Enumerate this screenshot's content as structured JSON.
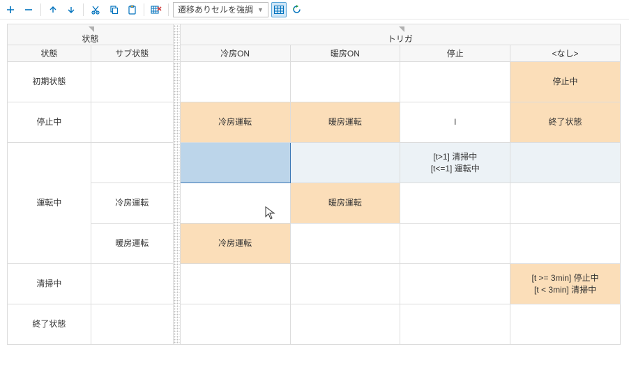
{
  "toolbar": {
    "dropdown": "遷移ありセルを強調"
  },
  "headers": {
    "state_group": "状態",
    "trigger_group": "トリガ",
    "state": "状態",
    "substate": "サブ状態",
    "trig1": "冷房ON",
    "trig2": "暖房ON",
    "trig3": "停止",
    "trig4": "<なし>"
  },
  "rows": {
    "r0_state": "初期状態",
    "r1_state": "停止中",
    "r2_state": "運転中",
    "r2_sub1": "冷房運転",
    "r2_sub2": "暖房運転",
    "r3_state": "清掃中",
    "r4_state": "終了状態"
  },
  "cells": {
    "r0_c4": "停止中",
    "r1_c1": "冷房運転",
    "r1_c2": "暖房運転",
    "r1_c3": "I",
    "r1_c4": "終了状態",
    "r2a_c3": "[t>1] 清掃中\n[t<=1] 運転中",
    "r2b_c2": "暖房運転",
    "r2c_c1": "冷房運転",
    "r3_c4": "[t >= 3min] 停止中\n[t < 3min] 清掃中"
  }
}
